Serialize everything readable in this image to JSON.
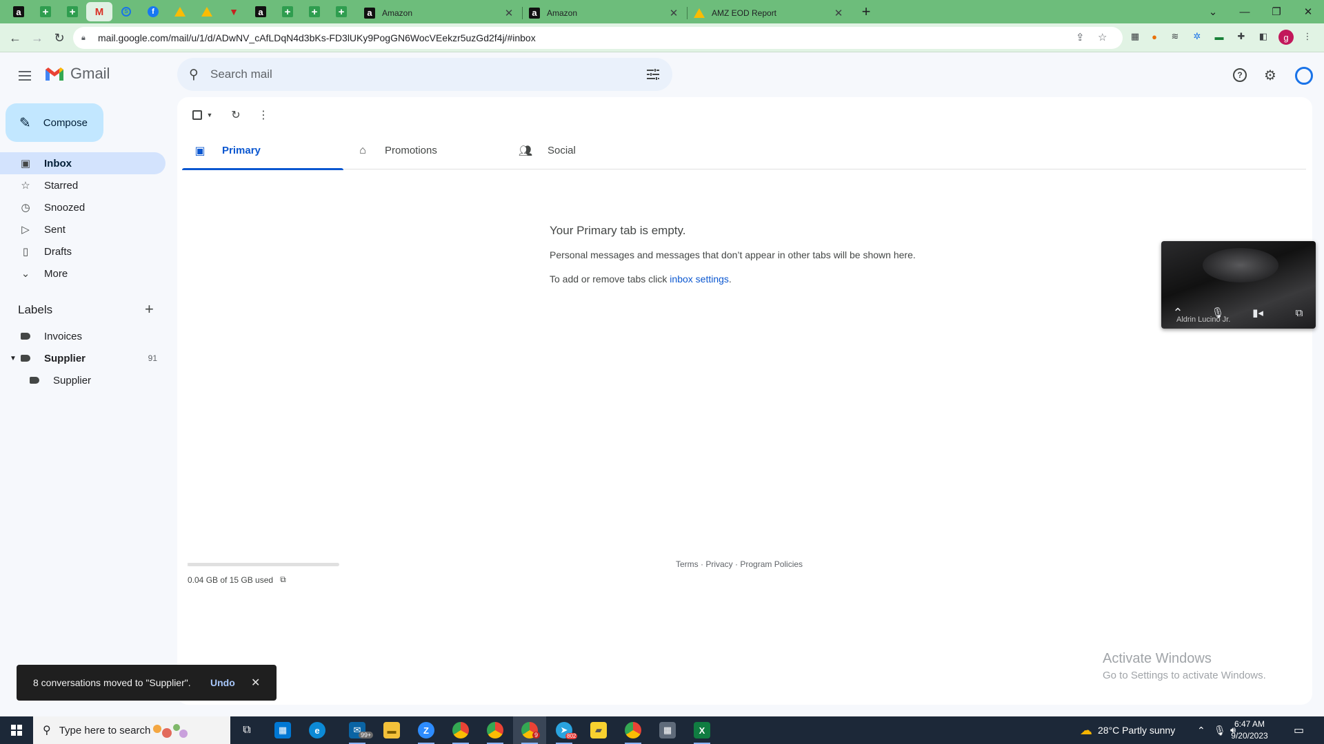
{
  "browser": {
    "tabs": [
      {
        "title": "Amazon"
      },
      {
        "title": "Amazon"
      },
      {
        "title": "AMZ EOD Report"
      }
    ],
    "url": "mail.google.com/mail/u/1/d/ADwNV_cAfLDqN4d3bKs-FD3lUKy9PogGN6WocVEekzr5uzGd2f4j/#inbox",
    "profile_initial": "g"
  },
  "gmail": {
    "brand": "Gmail",
    "search_placeholder": "Search mail",
    "compose_label": "Compose",
    "nav": [
      {
        "label": "Inbox",
        "icon": "inbox-icon"
      },
      {
        "label": "Starred",
        "icon": "star-icon"
      },
      {
        "label": "Snoozed",
        "icon": "clock-icon"
      },
      {
        "label": "Sent",
        "icon": "send-icon"
      },
      {
        "label": "Drafts",
        "icon": "draft-icon"
      },
      {
        "label": "More",
        "icon": "chevron-down-icon"
      }
    ],
    "labels_heading": "Labels",
    "labels": [
      {
        "label": "Invoices"
      },
      {
        "label": "Supplier",
        "count": "91"
      },
      {
        "label": "Supplier"
      }
    ],
    "tabs": [
      {
        "label": "Primary"
      },
      {
        "label": "Promotions"
      },
      {
        "label": "Social"
      }
    ],
    "empty": {
      "title": "Your Primary tab is empty.",
      "line1": "Personal messages and messages that don’t appear in other tabs will be shown here.",
      "line2_prefix": "To add or remove tabs click ",
      "line2_link": "inbox settings",
      "line2_suffix": "."
    },
    "storage": {
      "text": "0.04 GB of 15 GB used",
      "used_fraction": 0.0027
    },
    "footer": {
      "terms": "Terms",
      "privacy": "Privacy",
      "policies": "Program Policies",
      "sep": " · "
    }
  },
  "call_pip": {
    "participant": "Aldrin Lucino Jr."
  },
  "snackbar": {
    "message": "8 conversations moved to \"Supplier\".",
    "undo": "Undo"
  },
  "watermark": {
    "line1": "Activate Windows",
    "line2": "Go to Settings to activate Windows."
  },
  "taskbar": {
    "search_placeholder": "Type here to search",
    "weather": "28°C  Partly sunny",
    "time": "6:47 AM",
    "date": "9/20/2023",
    "mail_badge": "99+",
    "chrome_badge": "9",
    "telegram_badge": "802"
  }
}
